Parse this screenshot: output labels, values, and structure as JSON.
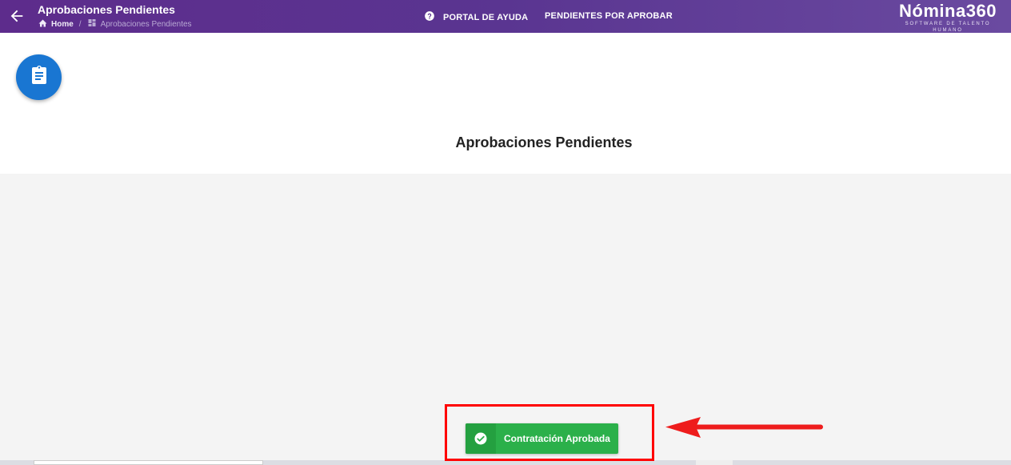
{
  "topbar": {
    "title": "Aprobaciones Pendientes",
    "breadcrumb": {
      "home": "Home",
      "separator": "/",
      "current": "Aprobaciones Pendientes"
    },
    "nav": {
      "help_label": "PORTAL DE AYUDA",
      "pending_label": "PENDIENTES POR APROBAR"
    },
    "logo": {
      "name": "Nómina360",
      "tagline": "SOFTWARE DE TALENTO HUMANO"
    },
    "icons": {
      "back": "arrow-left-icon",
      "home": "home-icon",
      "dashboard": "dashboard-icon",
      "help": "help-circle-icon"
    }
  },
  "header": {
    "fab_icon": "clipboard-icon",
    "page_title": "Aprobaciones Pendientes"
  },
  "toast": {
    "icon": "check-circle-icon",
    "message": "Contratación Aprobada"
  },
  "colors": {
    "topbar": "#5a3591",
    "fab": "#1976d2",
    "toast": "#2bb04a",
    "annotation": "#ff0000"
  }
}
